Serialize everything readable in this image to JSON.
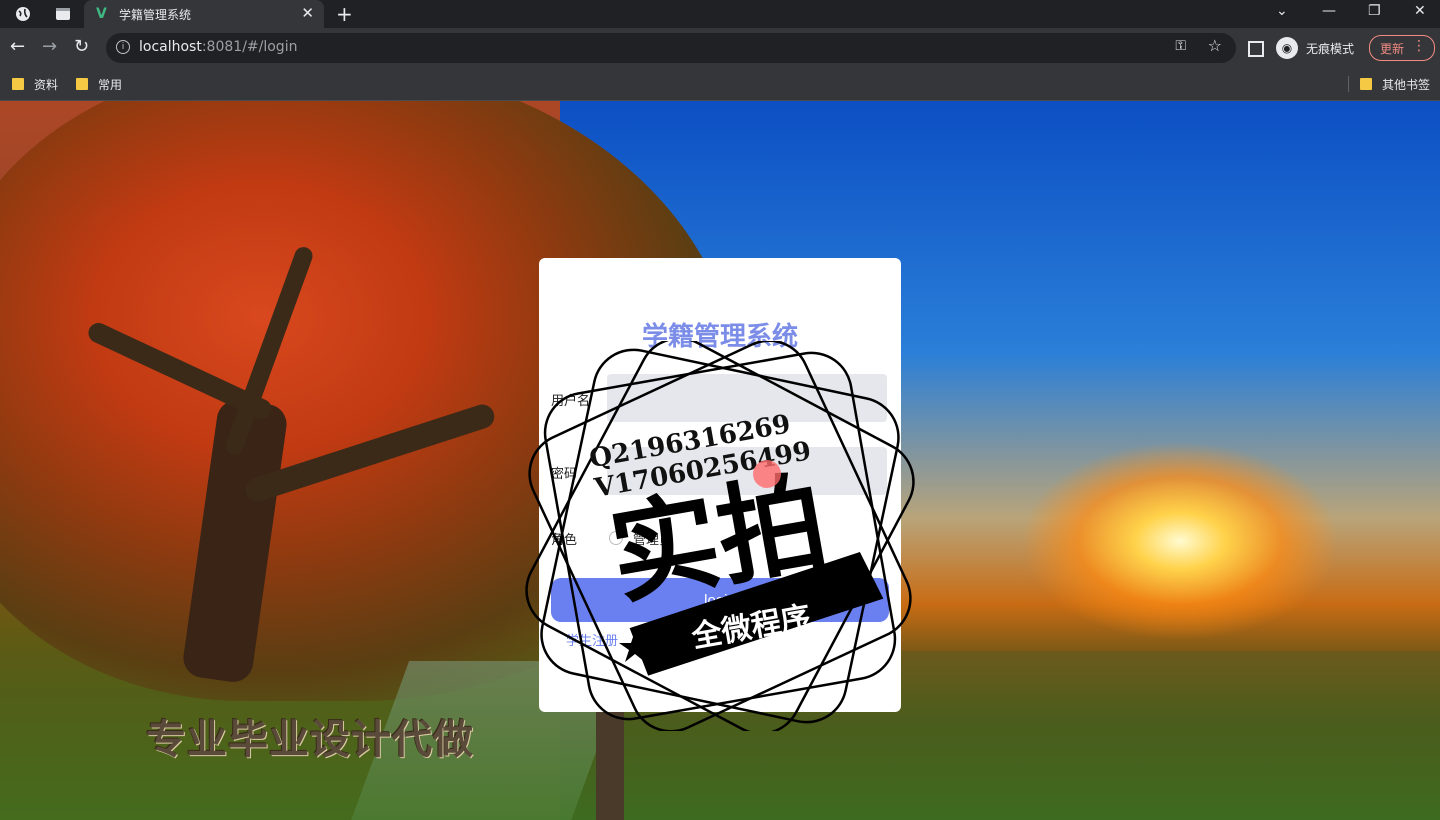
{
  "browser": {
    "tab": {
      "title": "学籍管理系统",
      "favicon": "V"
    },
    "url": {
      "host": "localhost",
      "rest": ":8081/#/login"
    },
    "incognito_label": "无痕模式",
    "update_label": "更新",
    "bookmarks": [
      {
        "label": "资料"
      },
      {
        "label": "常用"
      }
    ],
    "other_bookmarks": "其他书签"
  },
  "login": {
    "title": "学籍管理系统",
    "username_label": "用户名",
    "password_label": "密码",
    "role_label": "角色",
    "role_option": "管理员",
    "login_button": "login",
    "register_link": "学生注册"
  },
  "watermark": {
    "contact_q": "Q2196316269",
    "contact_v": "V17060256499",
    "big_text": "实拍",
    "banner_text": "全微程序"
  },
  "overlay_text": "专业毕业设计代做",
  "colors": {
    "accent": "#6b80f0",
    "title": "#7c8de8"
  }
}
